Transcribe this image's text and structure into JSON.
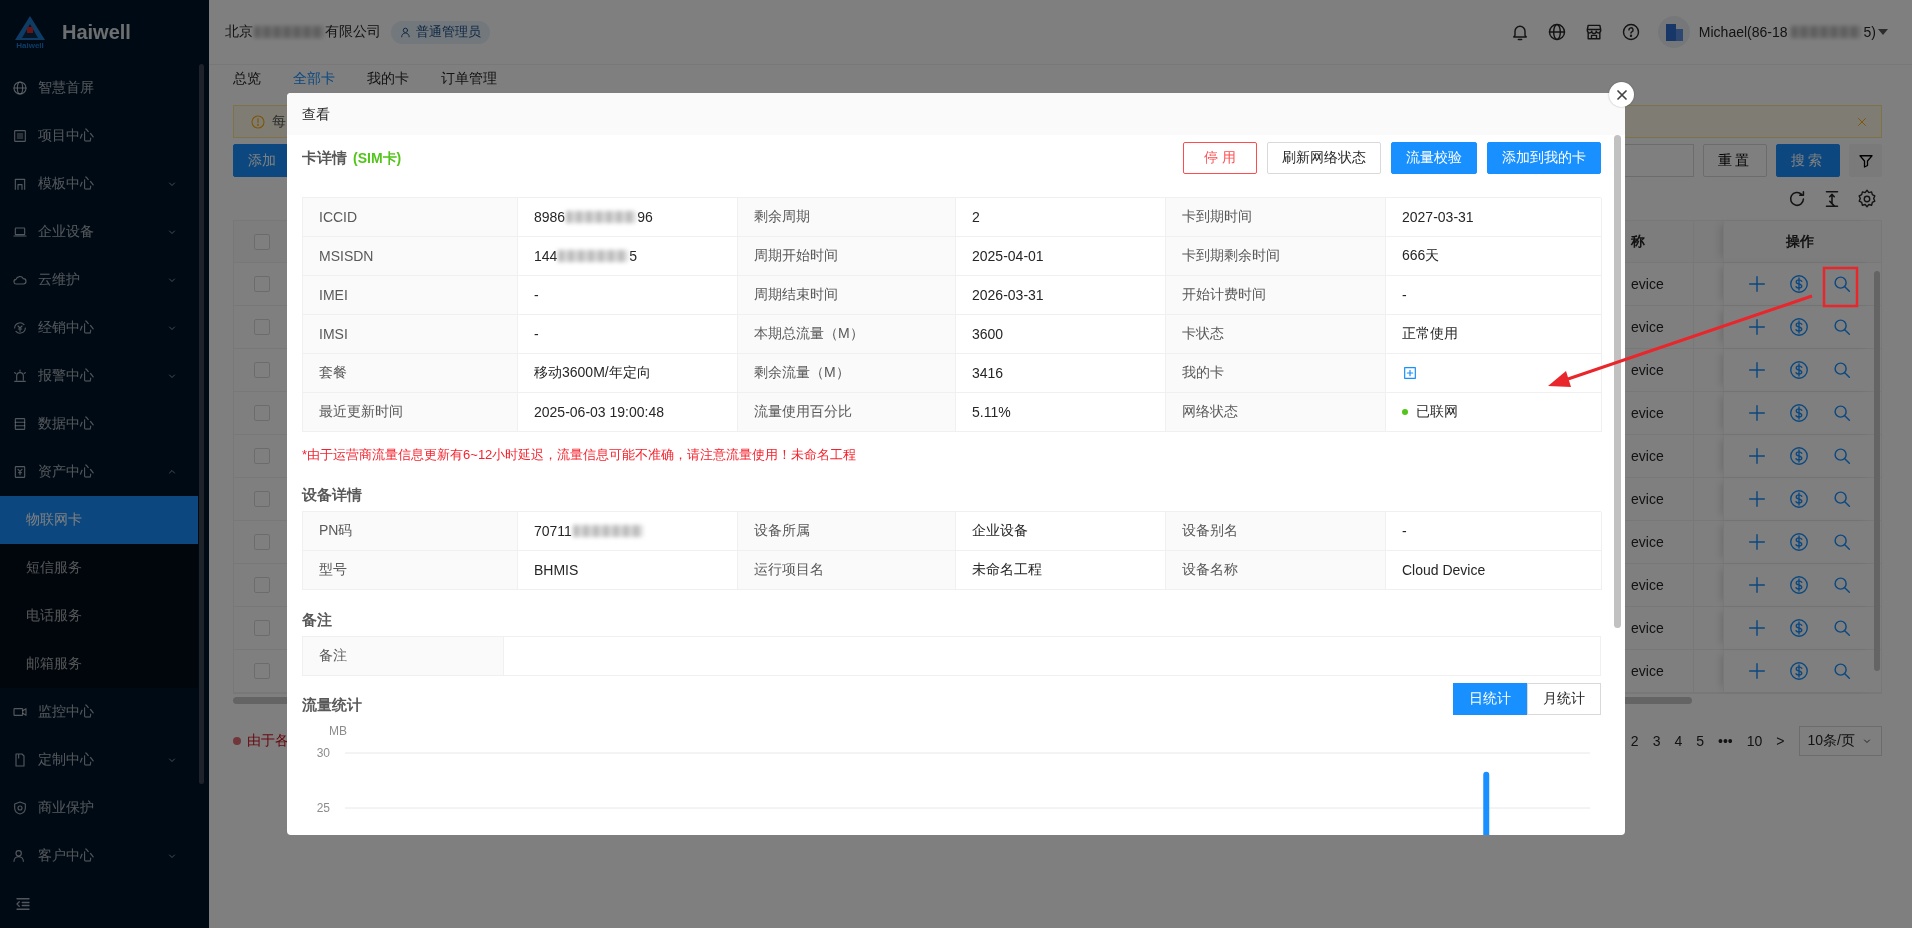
{
  "sidebar": {
    "brand": "Haiwell",
    "logo_subtext": "Haiwell",
    "items": [
      {
        "label": "智慧首屏",
        "expandable": false,
        "expanded": false,
        "selected": false
      },
      {
        "label": "项目中心",
        "expandable": false,
        "expanded": false,
        "selected": false
      },
      {
        "label": "模板中心",
        "expandable": true,
        "expanded": false,
        "selected": false
      },
      {
        "label": "企业设备",
        "expandable": true,
        "expanded": false,
        "selected": false
      },
      {
        "label": "云维护",
        "expandable": true,
        "expanded": false,
        "selected": false
      },
      {
        "label": "经销中心",
        "expandable": true,
        "expanded": false,
        "selected": false
      },
      {
        "label": "报警中心",
        "expandable": true,
        "expanded": false,
        "selected": false
      },
      {
        "label": "数据中心",
        "expandable": false,
        "expanded": false,
        "selected": false
      },
      {
        "label": "资产中心",
        "expandable": true,
        "expanded": true,
        "selected": false,
        "children": [
          {
            "label": "物联网卡",
            "selected": true
          },
          {
            "label": "短信服务",
            "selected": false
          },
          {
            "label": "电话服务",
            "selected": false
          },
          {
            "label": "邮箱服务",
            "selected": false
          }
        ]
      },
      {
        "label": "监控中心",
        "expandable": false,
        "expanded": false,
        "selected": false
      },
      {
        "label": "定制中心",
        "expandable": true,
        "expanded": false,
        "selected": false
      },
      {
        "label": "商业保护",
        "expandable": false,
        "expanded": false,
        "selected": false
      },
      {
        "label": "客户中心",
        "expandable": true,
        "expanded": false,
        "selected": false
      }
    ]
  },
  "header": {
    "company_prefix": "北京",
    "company_suffix": "有限公司",
    "role": "普通管理员",
    "user_prefix": "Michael(86-18",
    "user_suffix": "5)"
  },
  "page": {
    "tabs": [
      {
        "label": "总览",
        "selected": false
      },
      {
        "label": "全部卡",
        "selected": true
      },
      {
        "label": "我的卡",
        "selected": false
      },
      {
        "label": "订单管理",
        "selected": false
      }
    ],
    "alert_text": "每",
    "add_button": "添加",
    "reset_button": "重置",
    "search_button": "搜索",
    "table": {
      "columns": [
        "称",
        "操作"
      ],
      "header_checked": false,
      "rows": [
        {
          "name": "evice",
          "checked": false
        },
        {
          "name": "evice",
          "checked": false
        },
        {
          "name": "evice",
          "checked": false
        },
        {
          "name": "evice",
          "checked": false
        },
        {
          "name": "evice",
          "checked": false
        },
        {
          "name": "evice",
          "checked": false
        },
        {
          "name": "evice",
          "checked": false
        },
        {
          "name": "evice",
          "checked": false
        },
        {
          "name": "evice",
          "checked": false
        },
        {
          "name": "evice",
          "checked": false
        }
      ]
    },
    "footnote": "由于各",
    "pagination": {
      "pages": [
        "2",
        "3",
        "4",
        "5",
        "•••",
        "10"
      ],
      "next": ">",
      "page_size": "10条/页"
    }
  },
  "modal": {
    "title": "查看",
    "card_title": "卡详情",
    "card_type": "(SIM卡)",
    "buttons": [
      {
        "label": "停 用",
        "kind": "danger"
      },
      {
        "label": "刷新网络状态",
        "kind": "default"
      },
      {
        "label": "流量校验",
        "kind": "primary"
      },
      {
        "label": "添加到我的卡",
        "kind": "primary"
      }
    ],
    "card_fields": [
      [
        {
          "label": "ICCID",
          "kind": "redacted",
          "value": "8986",
          "suffix": "96"
        },
        {
          "label": "剩余周期",
          "kind": "text",
          "value": "2"
        },
        {
          "label": "卡到期时间",
          "kind": "text",
          "value": "2027-03-31"
        }
      ],
      [
        {
          "label": "MSISDN",
          "kind": "redacted",
          "value": "144",
          "suffix": "5"
        },
        {
          "label": "周期开始时间",
          "kind": "text",
          "value": "2025-04-01"
        },
        {
          "label": "卡到期剩余时间",
          "kind": "text",
          "value": "666天"
        }
      ],
      [
        {
          "label": "IMEI",
          "kind": "text",
          "value": "-"
        },
        {
          "label": "周期结束时间",
          "kind": "text",
          "value": "2026-03-31"
        },
        {
          "label": "开始计费时间",
          "kind": "text",
          "value": "-"
        }
      ],
      [
        {
          "label": "IMSI",
          "kind": "text",
          "value": "-"
        },
        {
          "label": "本期总流量（M）",
          "kind": "text",
          "value": "3600"
        },
        {
          "label": "卡状态",
          "kind": "text",
          "value": "正常使用"
        }
      ],
      [
        {
          "label": "套餐",
          "kind": "text",
          "value": "移动3600M/年定向"
        },
        {
          "label": "剩余流量（M）",
          "kind": "text",
          "value": "3416"
        },
        {
          "label": "我的卡",
          "kind": "add"
        }
      ],
      [
        {
          "label": "最近更新时间",
          "kind": "text",
          "value": "2025-06-03 19:00:48"
        },
        {
          "label": "流量使用百分比",
          "kind": "text",
          "value": "5.11%"
        },
        {
          "label": "网络状态",
          "kind": "status",
          "value": "已联网",
          "color": "#52c41a"
        }
      ]
    ],
    "notice": "*由于运营商流量信息更新有6~12小时延迟，流量信息可能不准确，请注意流量使用！未命名工程",
    "device_title": "设备详情",
    "device_fields": [
      [
        {
          "label": "PN码",
          "kind": "redacted",
          "value": "70711"
        },
        {
          "label": "设备所属",
          "kind": "text",
          "value": "企业设备"
        },
        {
          "label": "设备别名",
          "kind": "text",
          "value": "-"
        }
      ],
      [
        {
          "label": "型号",
          "kind": "text",
          "value": "BHMIS"
        },
        {
          "label": "运行项目名",
          "kind": "text",
          "value": "未命名工程"
        },
        {
          "label": "设备名称",
          "kind": "text",
          "value": "Cloud Device"
        }
      ]
    ],
    "remark_title": "备注",
    "remark_label": "备注",
    "traffic_title": "流量统计",
    "toggle": [
      {
        "label": "日统计",
        "selected": true
      },
      {
        "label": "月统计",
        "selected": false
      }
    ],
    "chart_data": {
      "type": "bar",
      "ylabel": "MB",
      "ylim": [
        0,
        30
      ],
      "yticks": [
        25,
        30
      ],
      "values": [
        null,
        null,
        null,
        null,
        null,
        null,
        null,
        null,
        null,
        null,
        null,
        null,
        null,
        null,
        null,
        null,
        null,
        null,
        null,
        null,
        null,
        null,
        null,
        null,
        null,
        null,
        null,
        28.3,
        null,
        null
      ]
    }
  }
}
